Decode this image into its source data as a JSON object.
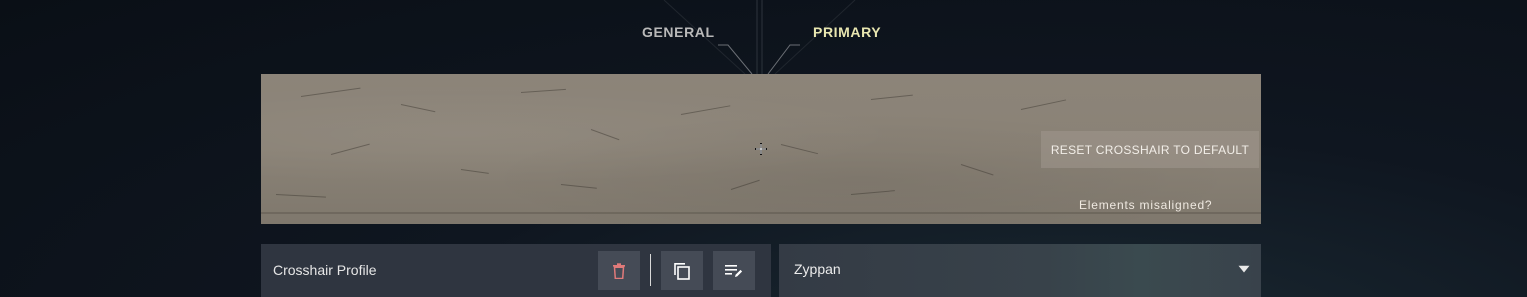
{
  "tabs": [
    {
      "label": "GENERAL",
      "active": false
    },
    {
      "label": "PRIMARY",
      "active": true
    }
  ],
  "preview": {
    "reset_label": "RESET CROSSHAIR TO DEFAULT",
    "misaligned_link": "Elements misaligned?"
  },
  "profile": {
    "label": "Crosshair Profile",
    "selected": "Zyppan",
    "actions": [
      "trash-icon",
      "copy-icon",
      "rename-icon"
    ]
  },
  "colors": {
    "active_tab": "#e8e6b0",
    "delete_icon": "#e07a7a",
    "panel": "#2f3540"
  }
}
